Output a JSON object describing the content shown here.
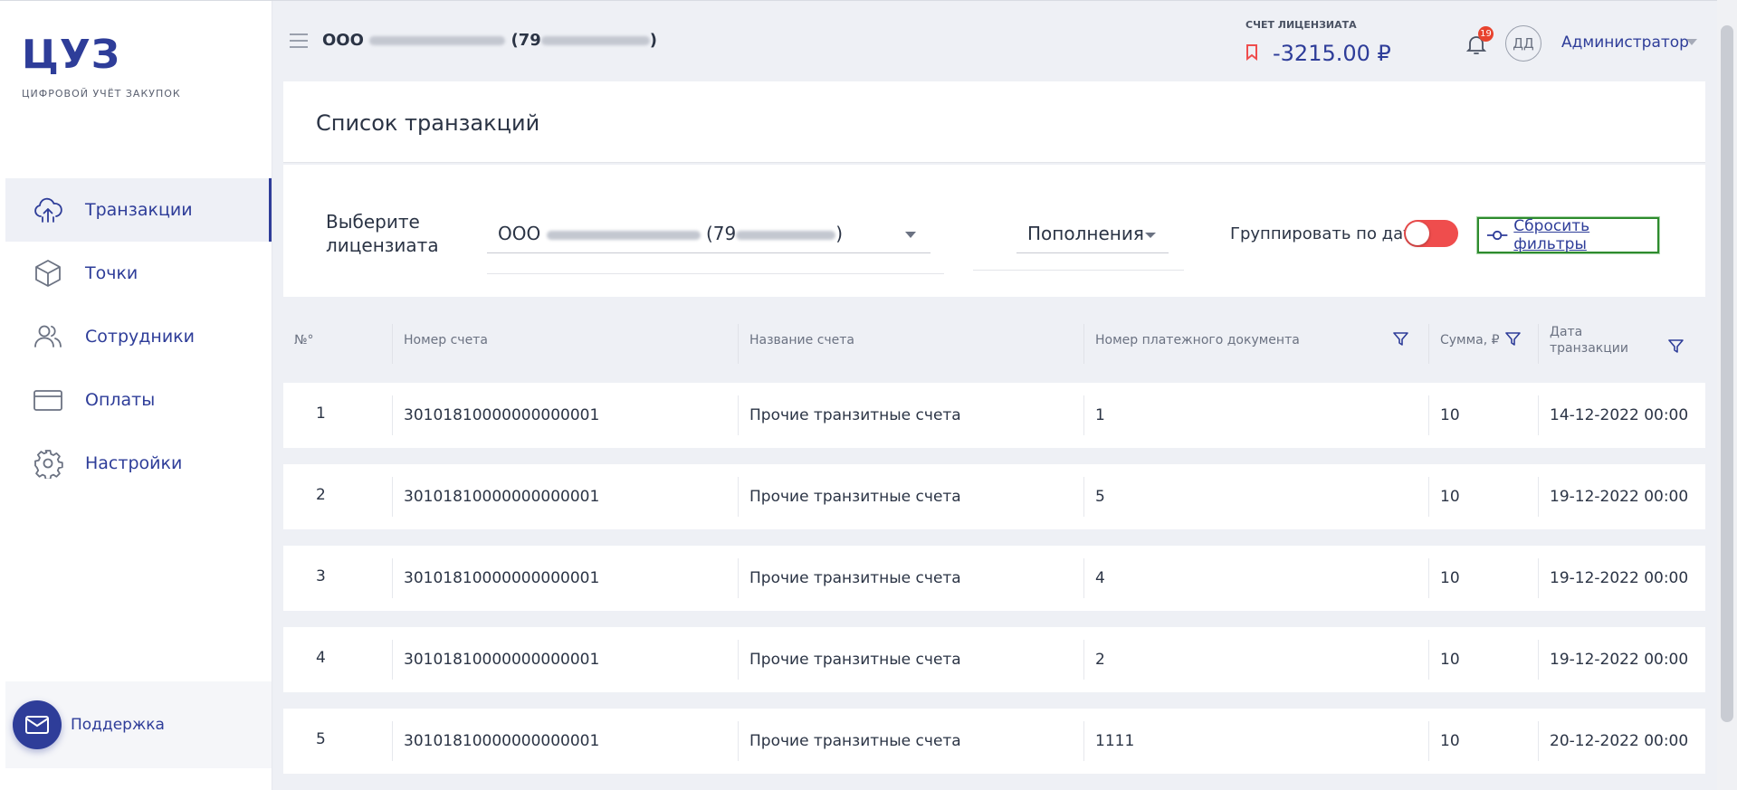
{
  "app": {
    "logo": "ЦУЗ",
    "logo_subtitle": "ЦИФРОВОЙ УЧЁТ ЗАКУПОК"
  },
  "sidebar": {
    "items": [
      {
        "label": "Транзакции",
        "icon": "cloud-upload-icon",
        "active": true
      },
      {
        "label": "Точки",
        "icon": "cube-icon",
        "active": false
      },
      {
        "label": "Сотрудники",
        "icon": "users-icon",
        "active": false
      },
      {
        "label": "Оплаты",
        "icon": "credit-card-icon",
        "active": false
      },
      {
        "label": "Настройки",
        "icon": "gear-icon",
        "active": false
      }
    ],
    "support_label": "Поддержка"
  },
  "header": {
    "org_prefix": "ООО",
    "org_suffix_open": "(79",
    "org_suffix_close": ")",
    "account_label": "СЧЕТ ЛИЦЕНЗИАТА",
    "account_value": "-3215.00 ₽",
    "notifications_count": "19",
    "avatar_initials": "ДД",
    "user_name": "Администратор"
  },
  "page": {
    "title": "Список транзакций"
  },
  "filters": {
    "licensee_label": "Выберите лицензиата",
    "licensee_prefix": "ООО",
    "licensee_suffix_open": "(79",
    "licensee_suffix_close": ")",
    "type_value": "Пополнения",
    "group_by_date_label": "Группировать по дате",
    "group_by_date_on": false,
    "reset_label": "Сбросить фильтры"
  },
  "table": {
    "columns": [
      "№°",
      "Номер счета",
      "Название счета",
      "Номер платежного документа",
      "Сумма, ₽",
      "Дата транзакции"
    ],
    "rows": [
      {
        "n": "1",
        "account": "30101810000000000001",
        "name": "Прочие транзитные счета",
        "doc": "1",
        "sum": "10",
        "date": "14-12-2022 00:00"
      },
      {
        "n": "2",
        "account": "30101810000000000001",
        "name": "Прочие транзитные счета",
        "doc": "5",
        "sum": "10",
        "date": "19-12-2022 00:00"
      },
      {
        "n": "3",
        "account": "30101810000000000001",
        "name": "Прочие транзитные счета",
        "doc": "4",
        "sum": "10",
        "date": "19-12-2022 00:00"
      },
      {
        "n": "4",
        "account": "30101810000000000001",
        "name": "Прочие транзитные счета",
        "doc": "2",
        "sum": "10",
        "date": "19-12-2022 00:00"
      },
      {
        "n": "5",
        "account": "30101810000000000001",
        "name": "Прочие транзитные счета",
        "doc": "1111",
        "sum": "10",
        "date": "20-12-2022 00:00"
      }
    ]
  },
  "colors": {
    "brand": "#2e3d99",
    "danger": "#ef4d4d",
    "badge": "#e8432e",
    "highlight_border": "#2e8b2e"
  }
}
